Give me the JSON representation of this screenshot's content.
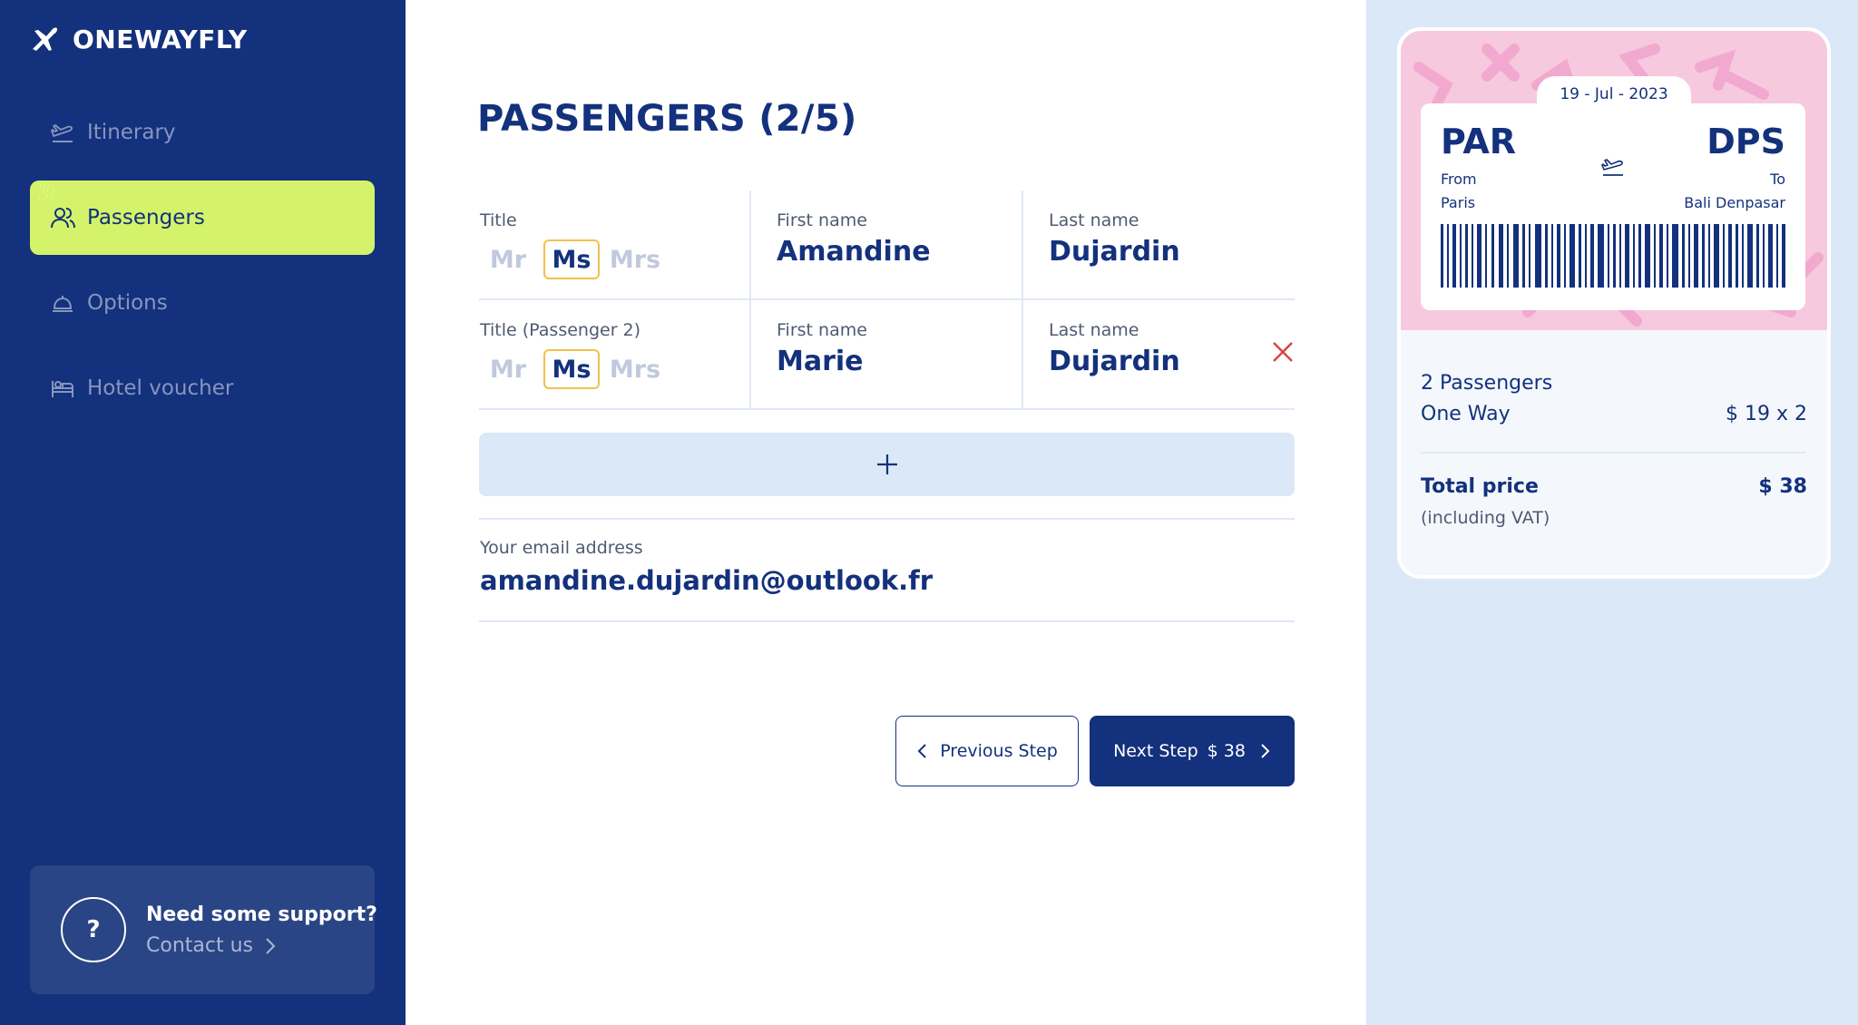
{
  "brand": {
    "name": "ONEWAYFLY"
  },
  "sidebar": {
    "items": [
      {
        "label": "Itinerary",
        "icon": "plane-takeoff-icon"
      },
      {
        "label": "Passengers",
        "icon": "users-icon",
        "active": true
      },
      {
        "label": "Options",
        "icon": "bell-icon"
      },
      {
        "label": "Hotel voucher",
        "icon": "bed-icon"
      }
    ],
    "support": {
      "title": "Need some support?",
      "link": "Contact us",
      "icon_text": "?"
    }
  },
  "main": {
    "title": "PASSENGERS (2/5)",
    "passengers": [
      {
        "title_label": "Title",
        "title_options": [
          "Mr",
          "Ms",
          "Mrs"
        ],
        "selected_title": "Ms",
        "first_name_label": "First name",
        "first_name": "Amandine",
        "last_name_label": "Last name",
        "last_name": "Dujardin"
      },
      {
        "title_label": "Title (Passenger 2)",
        "title_options": [
          "Mr",
          "Ms",
          "Mrs"
        ],
        "selected_title": "Ms",
        "first_name_label": "First name",
        "first_name": "Marie",
        "last_name_label": "Last name",
        "last_name": "Dujardin"
      }
    ],
    "email_label": "Your email address",
    "email": "amandine.dujardin@outlook.fr",
    "prev_button": "Previous Step",
    "next_button": "Next Step",
    "next_price": "$ 38"
  },
  "ticket": {
    "date": "19 - Jul - 2023",
    "from_code": "PAR",
    "to_code": "DPS",
    "from_label": "From",
    "to_label": "To",
    "from_city": "Paris",
    "to_city": "Bali Denpasar"
  },
  "summary": {
    "passengers": "2 Passengers",
    "trip_type": "One Way",
    "unit_price": "$ 19 x 2",
    "total_label": "Total price",
    "total_value": "$ 38",
    "vat_note": "(including VAT)"
  },
  "colors": {
    "navy": "#13317c",
    "accent_lime": "#d4f36a",
    "ticket_pink": "#f7c9df",
    "panel_blue": "#dbe8f8",
    "remove_red": "#d9453f",
    "selected_border": "#f0c24b"
  }
}
